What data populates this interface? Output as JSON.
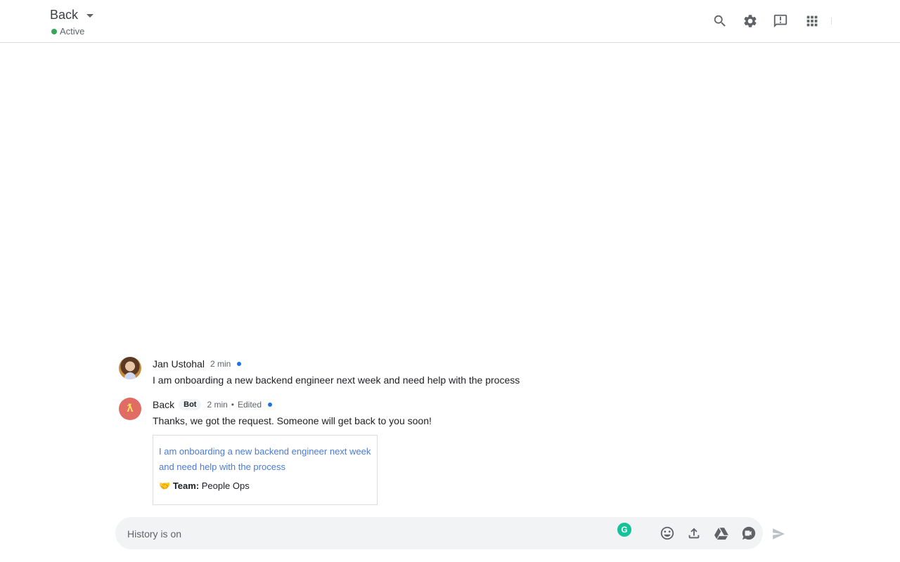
{
  "header": {
    "title": "Back",
    "status": "Active",
    "status_color": "#34a853",
    "icons": [
      "search-icon",
      "settings-icon",
      "feedback-icon",
      "apps-icon"
    ]
  },
  "messages": [
    {
      "sender": "Jan Ustohal",
      "time": "2 min",
      "text": "I am onboarding a new backend engineer next week and need help with the process"
    },
    {
      "sender": "Back",
      "badge": "Bot",
      "avatar_glyph": "ƛ",
      "time": "2 min",
      "separator": "•",
      "edited": "Edited",
      "text": "Thanks, we got the request. Someone will get back to you soon!",
      "card": {
        "link": "I am onboarding a new backend engineer next week and need help with the process",
        "emoji": "🤝",
        "team_label": "Team:",
        "team_value": "People Ops"
      }
    }
  ],
  "composer": {
    "placeholder": "History is on",
    "grammarly_glyph": "G",
    "icons": [
      "emoji-icon",
      "upload-icon",
      "drive-icon",
      "meet-icon",
      "send-icon"
    ]
  },
  "colors": {
    "accent": "#1a73e8",
    "link": "#4a7bd6",
    "bot_avatar": "#e06c64"
  }
}
